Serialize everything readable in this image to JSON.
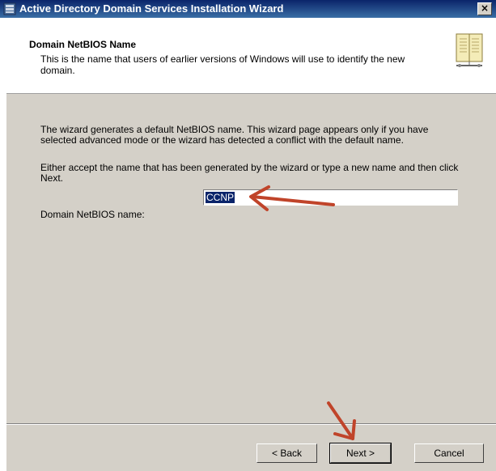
{
  "window": {
    "title": "Active Directory Domain Services Installation Wizard",
    "close_glyph": "×"
  },
  "header": {
    "title": "Domain NetBIOS Name",
    "description": "This is the name that users of earlier versions of Windows will use to identify the new domain."
  },
  "body": {
    "paragraph1": "The wizard generates a default NetBIOS name. This wizard page appears only if you have selected advanced mode or the wizard has detected a conflict with the default name.",
    "paragraph2": "Either accept the name that has been generated by the wizard or type a new name and then click Next."
  },
  "form": {
    "netbios_label": "Domain NetBIOS name:",
    "netbios_value": "CCNP"
  },
  "buttons": {
    "back": "< Back",
    "next": "Next >",
    "cancel": "Cancel"
  },
  "colors": {
    "annotation_arrow": "#c0442a",
    "title_bar": "#0a246a",
    "dialog_face": "#d4d0c8",
    "selection": "#0a246a"
  },
  "icons": {
    "app": "server-icon",
    "header": "directory-book-icon",
    "close": "close-icon"
  }
}
